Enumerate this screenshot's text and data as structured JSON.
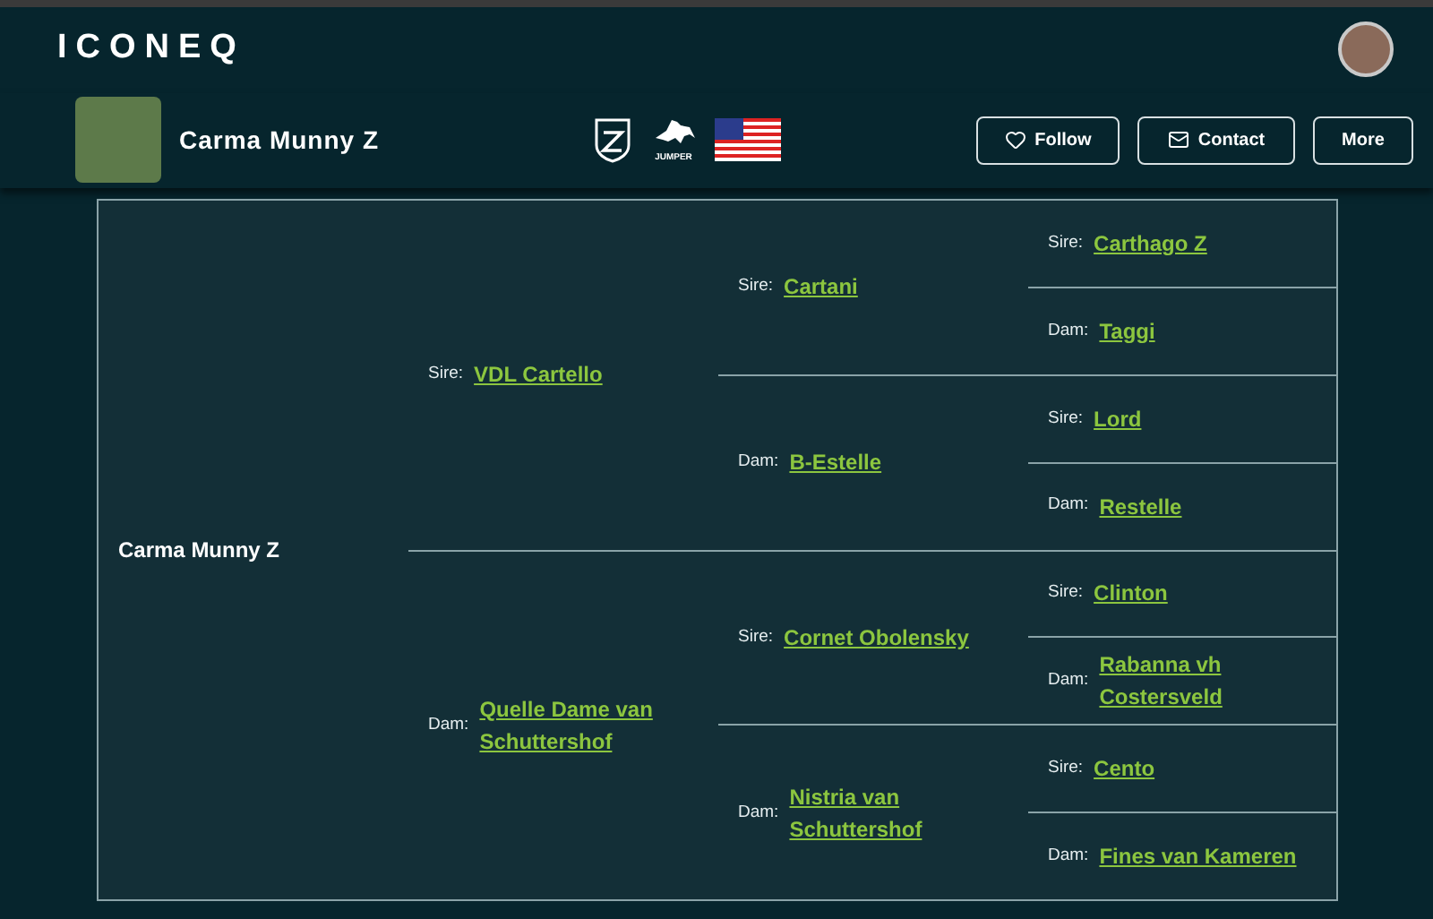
{
  "brand": "ICONEQ",
  "horse": {
    "name": "Carma Munny Z",
    "badge_caption": "JUMPER"
  },
  "buttons": [
    {
      "kind": "follow",
      "label": "Follow"
    },
    {
      "kind": "contact",
      "label": "Contact"
    },
    {
      "kind": "more",
      "label": "More"
    }
  ],
  "pedigree": {
    "name": "Carma Munny Z",
    "parents": [
      {
        "label": "Sire:",
        "name": "VDL Cartello",
        "parents": [
          {
            "label": "Sire:",
            "name": "Cartani",
            "parents": [
              {
                "label": "Sire:",
                "name": "Carthago Z"
              },
              {
                "label": "Dam:",
                "name": "Taggi"
              }
            ]
          },
          {
            "label": "Dam:",
            "name": "B-Estelle",
            "parents": [
              {
                "label": "Sire:",
                "name": "Lord"
              },
              {
                "label": "Dam:",
                "name": "Restelle"
              }
            ]
          }
        ]
      },
      {
        "label": "Dam:",
        "name": "Quelle Dame van Schuttershof",
        "parents": [
          {
            "label": "Sire:",
            "name": "Cornet Obolensky",
            "parents": [
              {
                "label": "Sire:",
                "name": "Clinton"
              },
              {
                "label": "Dam:",
                "name": "Rabanna vh Costersveld"
              }
            ]
          },
          {
            "label": "Dam:",
            "name": "Nistria van Schuttershof",
            "parents": [
              {
                "label": "Sire:",
                "name": "Cento"
              },
              {
                "label": "Dam:",
                "name": "Fines van Kameren"
              }
            ]
          }
        ]
      }
    ]
  }
}
